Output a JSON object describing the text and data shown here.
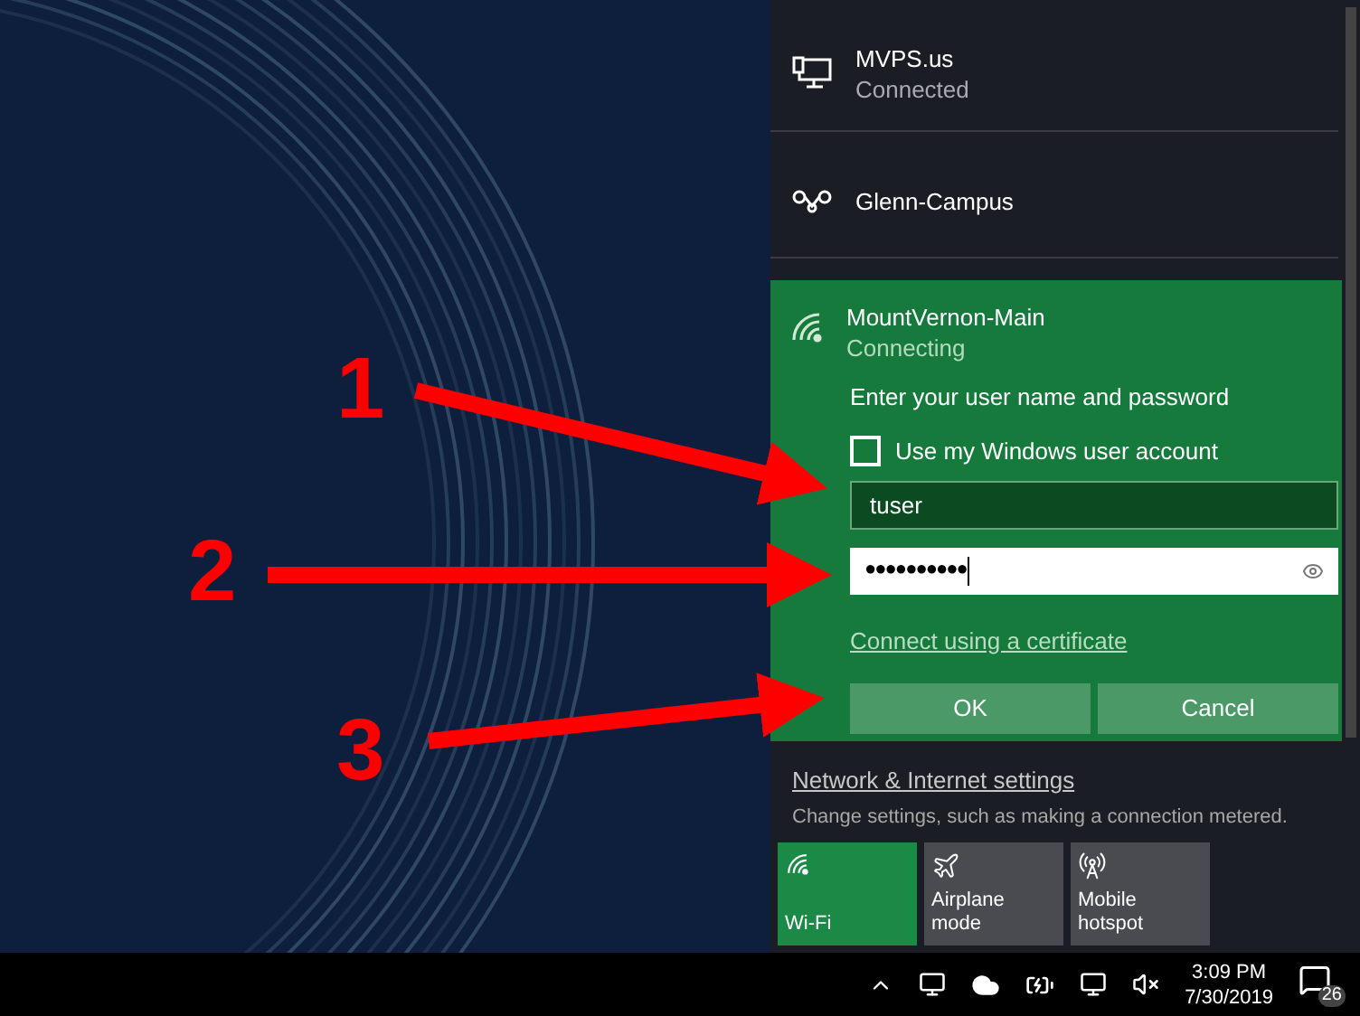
{
  "networks": [
    {
      "kind": "ethernet",
      "name": "MVPS.us",
      "status": "Connected"
    },
    {
      "kind": "vpn",
      "name": "Glenn-Campus"
    }
  ],
  "active_network": {
    "name": "MountVernon-Main",
    "status": "Connecting",
    "prompt": "Enter your user name and password",
    "checkbox": {
      "label": "Use my Windows user account",
      "checked": false
    },
    "username": {
      "value": "tuser"
    },
    "password": {
      "value": "●●●●●●●●●●"
    },
    "certificate_link": "Connect using a certificate",
    "buttons": [
      "OK",
      "Cancel"
    ]
  },
  "settings": {
    "link": "Network & Internet settings",
    "description": "Change settings, such as making a connection metered."
  },
  "quick_actions": [
    {
      "kind": "wifi",
      "label": "Wi-Fi",
      "on": true
    },
    {
      "kind": "airplane",
      "label": "Airplane mode",
      "on": false
    },
    {
      "kind": "hotspot",
      "label": "Mobile hotspot",
      "on": false
    }
  ],
  "taskbar": {
    "time": "3:09 PM",
    "date": "7/30/2019",
    "notification_count": "26"
  },
  "annotations": [
    "1",
    "2",
    "3"
  ]
}
